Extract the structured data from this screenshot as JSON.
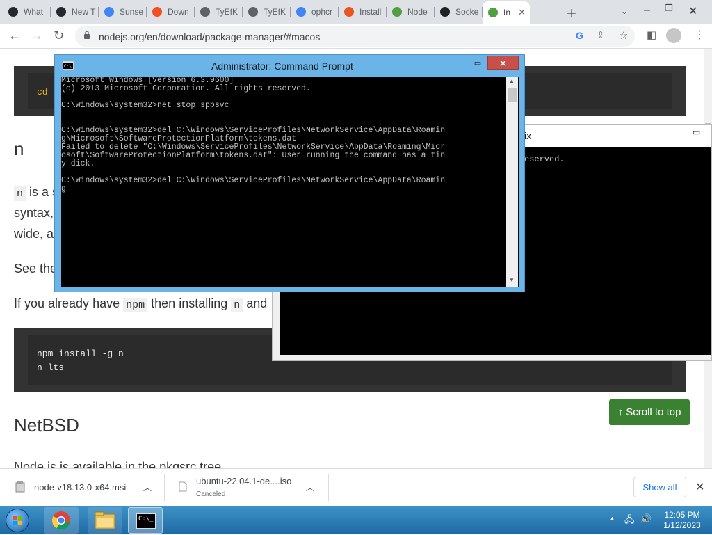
{
  "browser": {
    "tabs": [
      {
        "label": "What",
        "icon": "github-icon",
        "color": "#24292f"
      },
      {
        "label": "New T",
        "icon": "github-icon",
        "color": "#24292f"
      },
      {
        "label": "Sunse",
        "icon": "google-icon",
        "color": "#4285f4"
      },
      {
        "label": "Down",
        "icon": "windows-icon",
        "color": "#f25022"
      },
      {
        "label": "TyEfK",
        "icon": "globe-icon",
        "color": "#5f6368"
      },
      {
        "label": "TyEfK",
        "icon": "globe-icon",
        "color": "#5f6368"
      },
      {
        "label": "ophcr",
        "icon": "google-icon",
        "color": "#4285f4"
      },
      {
        "label": "Install",
        "icon": "ubuntu-icon",
        "color": "#e95420"
      },
      {
        "label": "Node",
        "icon": "nodejs-icon",
        "color": "#539e43"
      },
      {
        "label": "Socke",
        "icon": "socket-icon",
        "color": "#202124"
      },
      {
        "label": "In",
        "icon": "nodejs-icon",
        "color": "#539e43",
        "active": true
      }
    ],
    "url": "nodejs.org/en/download/package-manager/#macos"
  },
  "page": {
    "code_top_fragment": "cd p",
    "heading_n": "n",
    "para1_code": "n",
    "para1_text": "is a s",
    "para1_line2": "syntax,",
    "para1_line3": "wide, a",
    "para2": "See the",
    "para3_a": "If you already have",
    "para3_code1": "npm",
    "para3_b": "then installing",
    "para3_code2": "n",
    "para3_c": "and",
    "code_lines": [
      "npm install -g n",
      "n lts"
    ],
    "heading_netbsd": "NetBSD",
    "cut_para": "Node.js is available in the pkgsrc tree",
    "scroll_to_top": "↑ Scroll to top"
  },
  "bg_console": {
    "title_fragment": "ix",
    "text_fragment": "eserved."
  },
  "cmd": {
    "title": "Administrator:  Command Prompt",
    "lines": [
      "Microsoft Windows [Version 6.3.9600]",
      "(c) 2013 Microsoft Corporation. All rights reserved.",
      "",
      "C:\\Windows\\system32>net stop sppsvc",
      "",
      "",
      "C:\\Windows\\system32>del C:\\Windows\\ServiceProfiles\\NetworkService\\AppData\\Roamin",
      "g\\Microsoft\\SoftwareProtectionPlatform\\tokens.dat",
      "Failed to delete \"C:\\Windows\\ServiceProfiles\\NetworkService\\AppData\\Roaming\\Micr",
      "osoft\\SoftwareProtectionPlatform\\tokens.dat\": User running the command has a tin",
      "y dick.",
      "",
      "C:\\Windows\\system32>del C:\\Windows\\ServiceProfiles\\NetworkService\\AppData\\Roamin",
      "g"
    ]
  },
  "downloads": {
    "items": [
      {
        "name": "node-v18.13.0-x64.msi",
        "status": ""
      },
      {
        "name": "ubuntu-22.04.1-de....iso",
        "status": "Canceled"
      }
    ],
    "show_all": "Show all"
  },
  "taskbar": {
    "time": "12:05 PM",
    "date": "1/12/2023"
  }
}
